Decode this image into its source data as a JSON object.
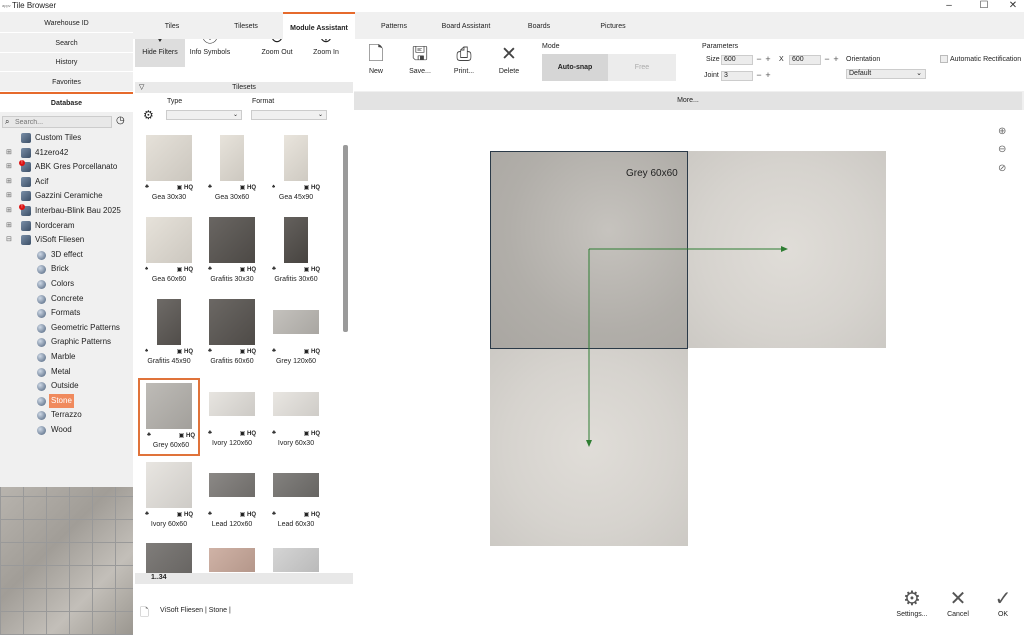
{
  "window": {
    "title": "Tile Browser",
    "app_icon": "appv",
    "controls": [
      "–",
      "☐",
      "✕"
    ]
  },
  "nav": {
    "warehouse": "Warehouse ID",
    "search": "Search",
    "history": "History",
    "favorites": "Favorites",
    "database": "Database",
    "search_placeholder": "Search..."
  },
  "tree": [
    {
      "label": "Custom Tiles",
      "level": 0,
      "type": "cube",
      "expander": ""
    },
    {
      "label": "41zero42",
      "level": 0,
      "type": "cube",
      "expander": "⊞"
    },
    {
      "label": "ABK Gres Porcellanato",
      "level": 0,
      "type": "cube",
      "expander": "⊞",
      "badge": "!"
    },
    {
      "label": "Acif",
      "level": 0,
      "type": "cube",
      "expander": "⊞"
    },
    {
      "label": "Gazzini Ceramiche",
      "level": 0,
      "type": "cube",
      "expander": "⊞"
    },
    {
      "label": "Interbau-Blink Bau 2025",
      "level": 0,
      "type": "cube",
      "expander": "⊞",
      "badge": "!"
    },
    {
      "label": "Nordceram",
      "level": 0,
      "type": "cube",
      "expander": "⊞"
    },
    {
      "label": "ViSoft Fliesen",
      "level": 0,
      "type": "cube",
      "expander": "⊟"
    },
    {
      "label": "3D effect",
      "level": 1,
      "type": "dot"
    },
    {
      "label": "Brick",
      "level": 1,
      "type": "dot"
    },
    {
      "label": "Colors",
      "level": 1,
      "type": "dot"
    },
    {
      "label": "Concrete",
      "level": 1,
      "type": "dot"
    },
    {
      "label": "Formats",
      "level": 1,
      "type": "dot"
    },
    {
      "label": "Geometric Patterns",
      "level": 1,
      "type": "dot"
    },
    {
      "label": "Graphic Patterns",
      "level": 1,
      "type": "dot"
    },
    {
      "label": "Marble",
      "level": 1,
      "type": "dot"
    },
    {
      "label": "Metal",
      "level": 1,
      "type": "dot"
    },
    {
      "label": "Outside",
      "level": 1,
      "type": "dot"
    },
    {
      "label": "Stone",
      "level": 1,
      "type": "dot",
      "selected": true
    },
    {
      "label": "Terrazzo",
      "level": 1,
      "type": "dot"
    },
    {
      "label": "Wood",
      "level": 1,
      "type": "dot"
    }
  ],
  "browser": {
    "hide_filters": "Hide Filters",
    "info_symbols": "Info Symbols",
    "zoom_out": "Zoom Out",
    "zoom_in": "Zoom In",
    "tilesets": "Tilesets",
    "type": "Type",
    "format": "Format",
    "page": "1..34",
    "path": "ViSoft Fliesen | Stone |"
  },
  "tiles": [
    {
      "name": "Gea 30x30",
      "shape": "sq",
      "tone": "#e2ddd4",
      "hq": "HQ",
      "icon": "♣"
    },
    {
      "name": "Gea 30x60",
      "shape": "tall",
      "tone": "#e4dfd6",
      "hq": "HQ",
      "icon": "♣"
    },
    {
      "name": "Gea 45x90",
      "shape": "tall",
      "tone": "#e6e1d8",
      "hq": "HQ",
      "icon": "♠"
    },
    {
      "name": "Gea 60x60",
      "shape": "sq",
      "tone": "#e3ded5",
      "hq": "HQ",
      "icon": "♠"
    },
    {
      "name": "Grafitis 30x30",
      "shape": "sq",
      "tone": "#55514d",
      "hq": "HQ",
      "icon": "♣"
    },
    {
      "name": "Grafitis 30x60",
      "shape": "tall",
      "tone": "#4f4b47",
      "hq": "HQ",
      "icon": "♣"
    },
    {
      "name": "Grafitis 45x90",
      "shape": "tall",
      "tone": "#5a5652",
      "hq": "HQ",
      "icon": "♠"
    },
    {
      "name": "Grafitis 60x60",
      "shape": "sq",
      "tone": "#57534f",
      "hq": "HQ",
      "icon": "♣"
    },
    {
      "name": "Grey 120x60",
      "shape": "wide",
      "tone": "#bcb9b4",
      "hq": "HQ",
      "icon": "♣"
    },
    {
      "name": "Grey 60x60",
      "shape": "sq",
      "tone": "#b5b2ad",
      "hq": "HQ",
      "icon": "♣",
      "selected": true
    },
    {
      "name": "Ivory 120x60",
      "shape": "wide",
      "tone": "#e4e1dc",
      "hq": "HQ",
      "icon": "♣"
    },
    {
      "name": "Ivory 60x30",
      "shape": "wide",
      "tone": "#e6e3de",
      "hq": "HQ",
      "icon": "♣"
    },
    {
      "name": "Ivory 60x60",
      "shape": "sq",
      "tone": "#e5e2dd",
      "hq": "HQ",
      "icon": "♣"
    },
    {
      "name": "Lead 120x60",
      "shape": "wide",
      "tone": "#7b7875",
      "hq": "HQ",
      "icon": "♣"
    },
    {
      "name": "Lead 60x30",
      "shape": "wide",
      "tone": "#72706d",
      "hq": "HQ",
      "icon": "♣"
    },
    {
      "name": "",
      "shape": "sq",
      "tone": "#6e6b68",
      "hq": "",
      "icon": ""
    },
    {
      "name": "",
      "shape": "wide",
      "tone": "#c9a89a",
      "hq": "",
      "icon": ""
    },
    {
      "name": "",
      "shape": "wide",
      "tone": "#cfcfcf",
      "hq": "",
      "icon": ""
    }
  ],
  "tabs": [
    "Tiles",
    "Tilesets",
    "Module Assistant",
    "Patterns",
    "Board Assistant",
    "Boards",
    "Pictures"
  ],
  "toolbar": {
    "new": "New",
    "save": "Save...",
    "print": "Print...",
    "delete": "Delete"
  },
  "mode": {
    "label": "Mode",
    "auto": "Auto-snap",
    "free": "Free"
  },
  "params": {
    "label": "Parameters",
    "size": "Size",
    "size_w": "600",
    "size_h": "600",
    "x": "X",
    "joint": "Joint",
    "joint_v": "3",
    "minus": "−",
    "plus": "+",
    "orientation": "Orientation",
    "orientation_v": "Default",
    "auto_rect": "Automatic Rectification"
  },
  "more": "More...",
  "canvas": {
    "tile_label": "Grey 60x60"
  },
  "bottom": {
    "settings": "Settings...",
    "cancel": "Cancel",
    "ok": "OK"
  },
  "colors": {
    "accent": "#e66a2c",
    "arrow": "#2e7d32",
    "tile_border": "#2b3a48"
  }
}
